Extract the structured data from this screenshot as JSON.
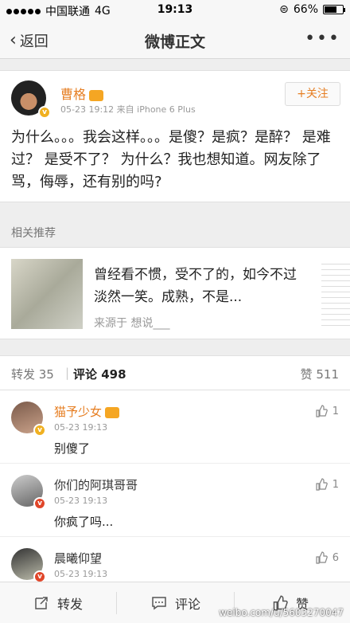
{
  "status_bar": {
    "carrier": "中国联通",
    "network": "4G",
    "time": "19:13",
    "battery": "66%",
    "battery_level": 0.66
  },
  "nav": {
    "back_label": "返回",
    "title": "微博正文",
    "more": "•••"
  },
  "post": {
    "author": "曹格",
    "time": "05-23 19:12",
    "source": "来自 iPhone 6 Plus",
    "follow_label": "+关注",
    "text": "为什么。。。我会这样。。。是傻？是疯？是醉？ 是难过？ 是受不了？ 为什么？我也想知道。网友除了骂，侮辱，还有别的吗?"
  },
  "recommend": {
    "header": "相关推荐",
    "text": "曾经看不惯，受不了的，如今不过淡然一笑。成熟，不是...",
    "source": "来源于 想说___"
  },
  "tabs": {
    "repost": "转发 35",
    "separator": "|",
    "comment": "评论 498",
    "like": "赞 511"
  },
  "comments": [
    {
      "name": "猫予少女",
      "time": "05-23 19:13",
      "text": "别傻了",
      "likes": "1",
      "name_color": "#e67e22"
    },
    {
      "name": "你们的阿琪哥哥",
      "time": "05-23 19:13",
      "text": "你疯了吗...",
      "likes": "1",
      "name_color": "#333333"
    },
    {
      "name": "晨曦仰望",
      "time": "05-23 19:13",
      "text": "",
      "likes": "6",
      "name_color": "#333333"
    }
  ],
  "bottom_bar": {
    "repost": "转发",
    "comment": "评论",
    "like": "赞"
  },
  "watermark": "weibo.com/u/5603270047"
}
